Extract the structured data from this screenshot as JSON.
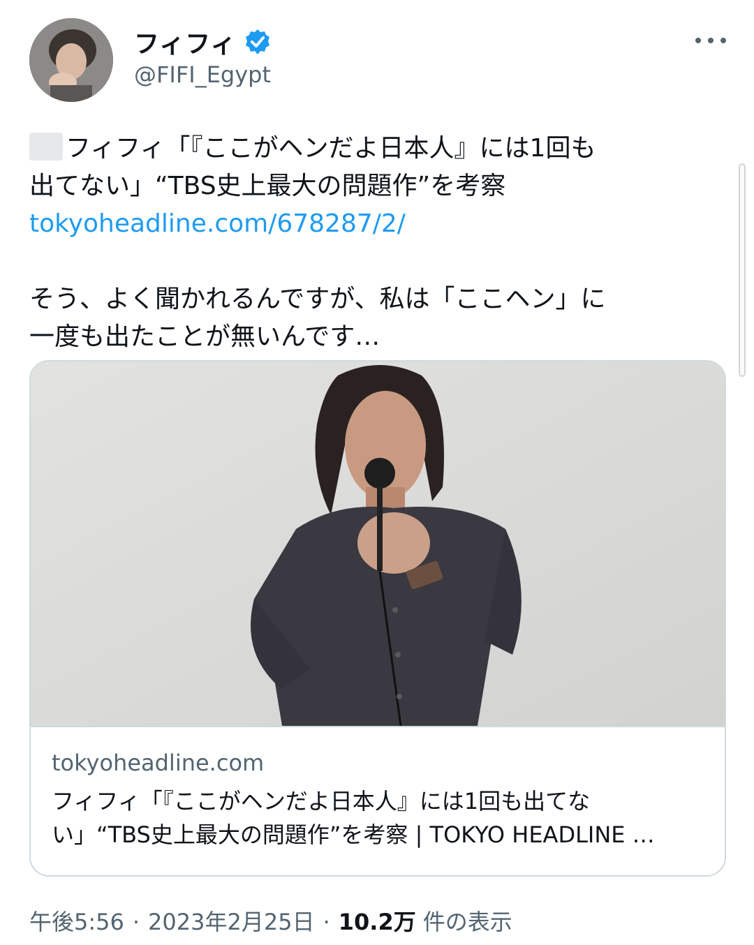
{
  "author": {
    "display_name": "フィフィ",
    "handle": "@FIFI_Egypt",
    "verified": true
  },
  "tweet": {
    "line1": "フィフィ「『ここがヘンだよ日本人』には1回も",
    "line2": "出てない」“TBS史上最大の問題作”を考察",
    "link": "tokyoheadline.com/678287/2/",
    "line4": "そう、よく聞かれるんですが、私は「ここヘン」に",
    "line5": "一度も出たことが無いんです…"
  },
  "card": {
    "domain": "tokyoheadline.com",
    "title": "フィフィ「『ここがヘンだよ日本人』には1回も出てな\nい」“TBS史上最大の問題作”を考察 | TOKYO HEADLINE …"
  },
  "meta": {
    "time": "午後5:56",
    "separator": "·",
    "date": "2023年2月25日",
    "views_count": "10.2万",
    "views_label": "件の表示"
  },
  "colors": {
    "link": "#1d9bf0",
    "secondary_text": "#536471",
    "verified_badge": "#1d9bf0",
    "card_border": "#cfd9de"
  },
  "icons": {
    "verified": "verified-badge-icon",
    "more": "more-options-icon"
  }
}
